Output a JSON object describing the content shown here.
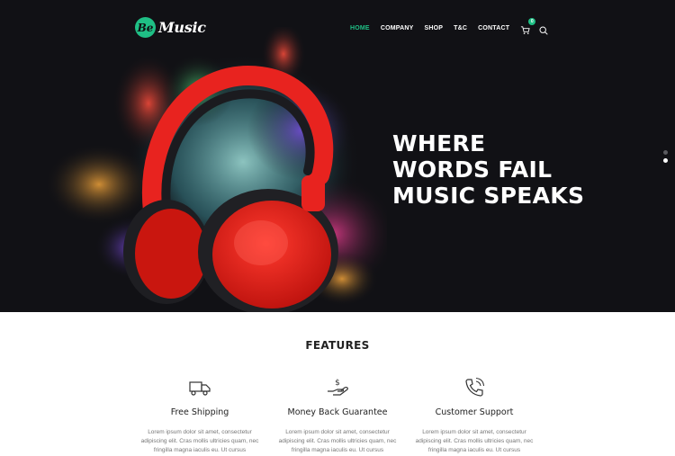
{
  "brand": {
    "badge": "Be",
    "name": "Music"
  },
  "nav": {
    "items": [
      {
        "label": "HOME",
        "active": true
      },
      {
        "label": "COMPANY"
      },
      {
        "label": "SHOP"
      },
      {
        "label": "T&C"
      },
      {
        "label": "CONTACT"
      }
    ],
    "cart_count": "0",
    "icons": [
      "cart-icon",
      "search-icon"
    ]
  },
  "hero": {
    "headline": [
      "WHERE",
      "WORDS FAIL",
      "MUSIC SPEAKS"
    ],
    "slider_dots": 2,
    "active_dot": 1,
    "image": "red-headphones-with-color-powder-burst"
  },
  "features": {
    "title": "FEATURES",
    "items": [
      {
        "icon": "truck-icon",
        "title": "Free Shipping",
        "text": "Lorem ipsum dolor sit amet, consectetur adipiscing elit. Cras mollis ultricies quam, nec fringilla magna iaculis eu. Ut cursus"
      },
      {
        "icon": "money-hand-icon",
        "title": "Money Back Guarantee",
        "text": "Lorem ipsum dolor sit amet, consectetur adipiscing elit. Cras mollis ultricies quam, nec fringilla magna iaculis eu. Ut cursus"
      },
      {
        "icon": "phone-icon",
        "title": "Customer Support",
        "text": "Lorem ipsum dolor sit amet, consectetur adipiscing elit. Cras mollis ultricies quam, nec fringilla magna iaculis eu. Ut cursus"
      }
    ]
  },
  "colors": {
    "accent": "#1fbf85",
    "hero_bg": "#111115",
    "headphone": "#e8231f"
  }
}
